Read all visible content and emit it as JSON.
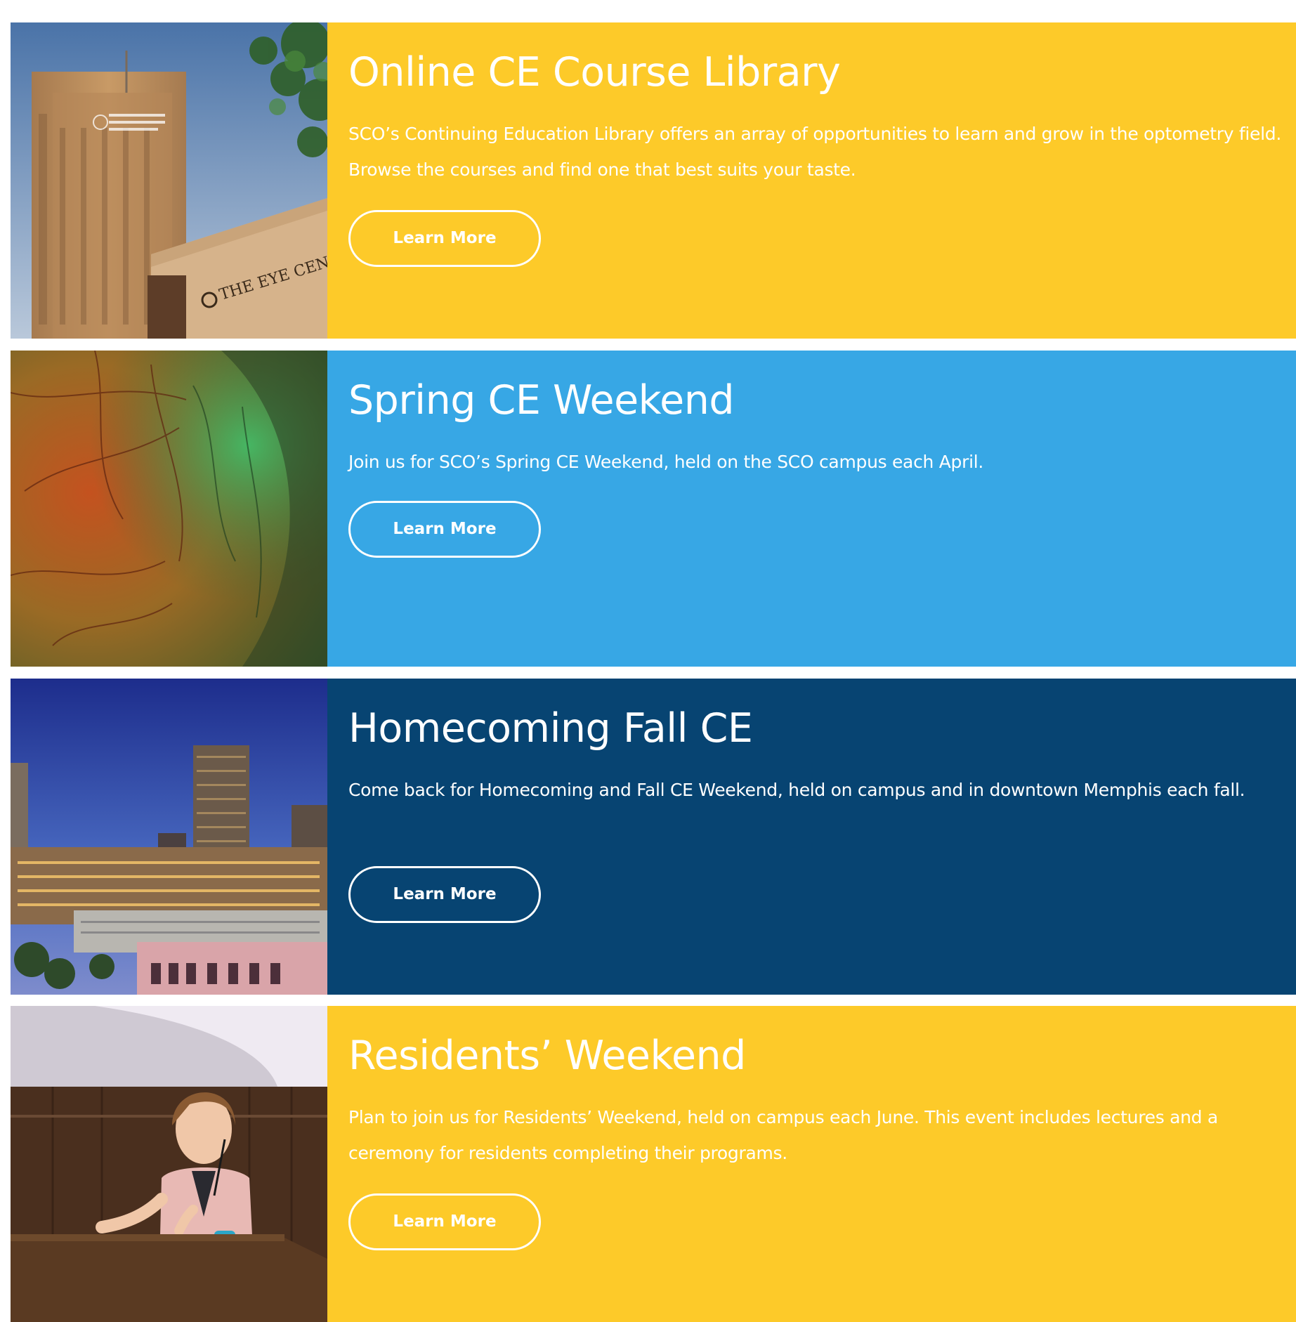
{
  "theme": {
    "yellow": "#fdca29",
    "light_blue": "#37a7e5",
    "navy": "#074472",
    "text": "#ffffff"
  },
  "cards": [
    {
      "title": "Online CE Course Library",
      "description": "SCO’s Continuing Education Library offers an array of opportunities to learn and grow in the optometry field. Browse the courses and find one that best suits your taste.",
      "button_label": "Learn More",
      "color": "#fdca29",
      "image": "eye-center-building-photo",
      "image_sign_text": "THE EYE CENTER"
    },
    {
      "title": "Spring CE Weekend",
      "description": "Join us for SCO’s Spring CE Weekend, held on the SCO campus each April.",
      "button_label": "Learn More",
      "color": "#37a7e5",
      "image": "retina-photo"
    },
    {
      "title": "Homecoming Fall CE",
      "description": "Come back for Homecoming and Fall CE Weekend, held on campus and in downtown Memphis each fall.",
      "button_label": "Learn More",
      "color": "#074472",
      "image": "memphis-skyline-photo"
    },
    {
      "title": "Residents’ Weekend",
      "description": "Plan to join us for Residents’ Weekend, held on campus each June. This event includes lectures and a ceremony for residents completing their programs.",
      "button_label": "Learn More",
      "color": "#fdca29",
      "image": "speaker-at-podium-photo"
    }
  ]
}
